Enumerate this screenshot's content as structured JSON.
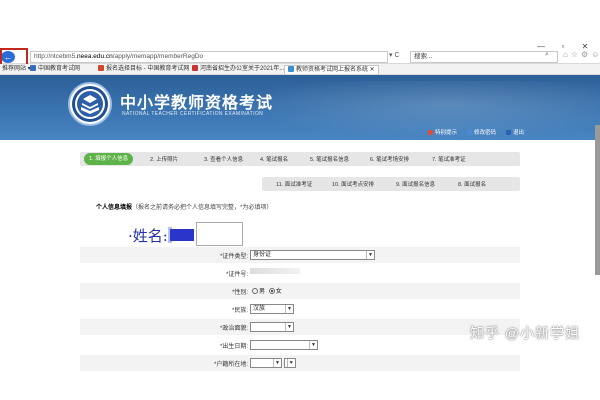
{
  "browser": {
    "url_prefix": "http://ntcebm5.",
    "url_host": "neea.edu.cn",
    "url_suffix": "/apply/memapp/memberRegDo",
    "url_actions": "▾ C",
    "search_placeholder": "搜索...",
    "window_controls": [
      "—",
      "▫",
      "✕"
    ],
    "toolbar_icons": [
      "⌂",
      "☆",
      "⚙",
      "☺"
    ],
    "favorites_label": "推荐网站 ▾",
    "tabs": [
      {
        "label": "中国教育考试网",
        "color": "#3a6bc0"
      },
      {
        "label": "报名选择目标 - 中国教育考试网",
        "color": "#d04a2a"
      },
      {
        "label": "河南省招生办公室关于2021年...",
        "color": "#c73232"
      },
      {
        "label": "教师资格考试网上报名系统",
        "color": "#3a8fd0"
      }
    ]
  },
  "header": {
    "title": "中小学教师资格考试",
    "subtitle": "NATIONAL TEACHER CERTIFICATION EXAMINATION",
    "links": [
      {
        "label": "特别提示",
        "color": "#e24b3b"
      },
      {
        "label": "修改密码",
        "color": "#4a8ad8"
      },
      {
        "label": "退出",
        "color": "#2a62b8"
      }
    ]
  },
  "steps": {
    "row1": [
      {
        "label": "1. 填报个人信息",
        "active": true
      },
      {
        "label": "2. 上传照片",
        "active": false
      },
      {
        "label": "3. 查看个人信息",
        "active": false
      },
      {
        "label": "4. 笔试报名",
        "active": false
      },
      {
        "label": "5. 笔试报名信息",
        "active": false
      },
      {
        "label": "6. 笔试考场安排",
        "active": false
      },
      {
        "label": "7. 笔试准考证",
        "active": false
      }
    ],
    "row2": [
      {
        "label": "11. 面试准考证"
      },
      {
        "label": "10. 面试考点安排"
      },
      {
        "label": "9. 面试报名信息"
      },
      {
        "label": "8. 面试报名"
      }
    ]
  },
  "form": {
    "section_title": "个人信息填报",
    "section_note": "（报名之前请务必把个人信息填写完整，*为必填项）",
    "name_caption": "·姓名:",
    "fields": {
      "id_type_label": "*证件类型:",
      "id_type_value": "身份证",
      "id_number_label": "*证件号:",
      "gender_label": "*性别:",
      "gender_male": "男",
      "gender_female": "女",
      "ethnicity_label": "*民族:",
      "ethnicity_value": "汉族",
      "political_label": "*政治面貌:",
      "political_value": "",
      "birthdate_label": "*出生日期:",
      "birthdate_value": "",
      "household_label": "*户籍所在地:"
    }
  },
  "watermark": "知乎 @小新学姐"
}
